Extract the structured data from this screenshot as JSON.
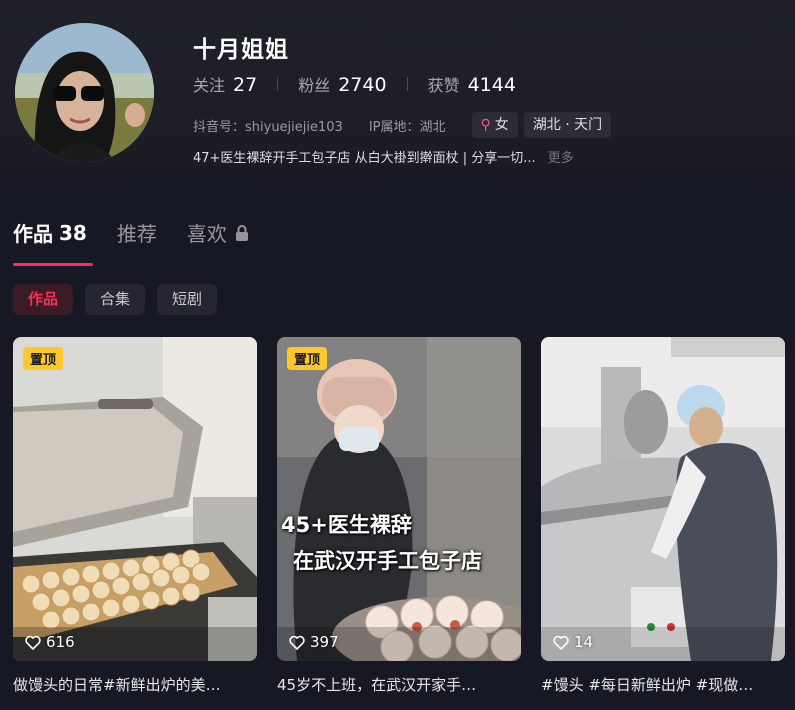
{
  "profile": {
    "nickname": "十月姐姐",
    "stats": [
      {
        "label": "关注",
        "value": "27"
      },
      {
        "label": "粉丝",
        "value": "2740"
      },
      {
        "label": "获赞",
        "value": "4144"
      }
    ],
    "douyin_id": "抖音号：shiyuejiejie103",
    "ip_location": "IP属地：湖北",
    "gender_tag": "女",
    "region_tag": "湖北 · 天门",
    "bio": "47+医生裸辞开手工包子店 从白大褂到擀面杖 | 分享一切...",
    "bio_more": "更多"
  },
  "tabs": {
    "works_label": "作品",
    "works_count": "38",
    "recommend_label": "推荐",
    "likes_label": "喜欢"
  },
  "filters": [
    "作品",
    "合集",
    "短剧"
  ],
  "videos": [
    {
      "pinned_label": "置顶",
      "likes": "616",
      "caption": "做馒头的日常#新鲜出炉的美…"
    },
    {
      "pinned_label": "置顶",
      "likes": "397",
      "caption": "45岁不上班，在武汉开家手…",
      "overlay_line1": "45+医生裸辞",
      "overlay_line2": "在武汉开手工包子店"
    },
    {
      "likes": "14",
      "caption": "#馒头 #每日新鲜出炉 #现做…"
    }
  ],
  "colors": {
    "background": "#161823",
    "accent": "#fe2c55",
    "pin_badge": "#ffc72a"
  },
  "icons": [
    "female-icon",
    "lock-icon",
    "heart-icon"
  ]
}
